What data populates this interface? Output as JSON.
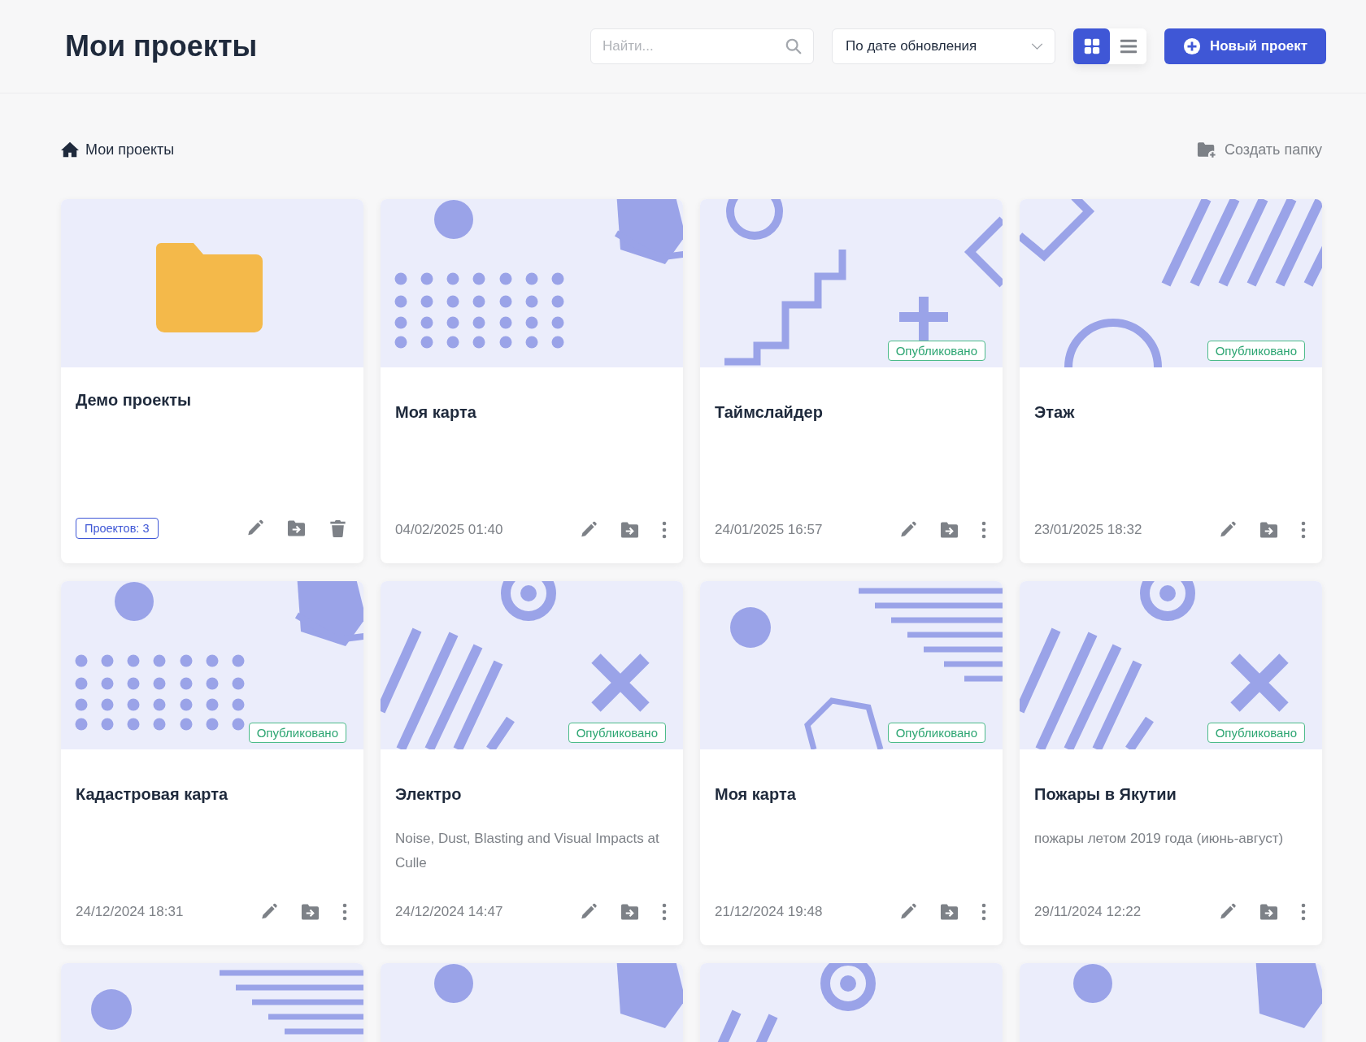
{
  "header": {
    "title": "Мои проекты",
    "search": {
      "placeholder": "Найти..."
    },
    "sort": {
      "value": "По дате обновления"
    },
    "view_modes": [
      {
        "kind": "grid",
        "selected": true
      },
      {
        "kind": "list",
        "selected": false
      }
    ],
    "new_button": "Новый проект"
  },
  "breadcrumb": {
    "label": "Мои проекты"
  },
  "create_folder": "Создать папку",
  "cards": [
    {
      "kind": "folder",
      "thumbnail": {
        "kind": "folder"
      },
      "published": false,
      "title": "Демо проекты",
      "count": "Проектов: 3"
    },
    {
      "kind": "project",
      "thumbnail": {
        "kind": "dots"
      },
      "published": false,
      "title": "Моя карта",
      "date": "04/02/2025 01:40"
    },
    {
      "kind": "project",
      "thumbnail": {
        "kind": "steps"
      },
      "published": true,
      "badge": "Опубликовано",
      "title": "Таймслайдер",
      "date": "24/01/2025 16:57"
    },
    {
      "kind": "project",
      "thumbnail": {
        "kind": "stripes"
      },
      "published": true,
      "badge": "Опубликовано",
      "title": "Этаж",
      "date": "23/01/2025 18:32"
    },
    {
      "kind": "project",
      "thumbnail": {
        "kind": "dots"
      },
      "published": true,
      "badge": "Опубликовано",
      "title": "Кадастровая карта",
      "date": "24/12/2024 18:31"
    },
    {
      "kind": "project",
      "thumbnail": {
        "kind": "cross"
      },
      "published": true,
      "badge": "Опубликовано",
      "title": "Электро",
      "description": "Noise, Dust, Blasting and Visual Impacts at Culle",
      "date": "24/12/2024 14:47"
    },
    {
      "kind": "project",
      "thumbnail": {
        "kind": "lines"
      },
      "published": true,
      "badge": "Опубликовано",
      "title": "Моя карта",
      "date": "21/12/2024 19:48"
    },
    {
      "kind": "project",
      "thumbnail": {
        "kind": "cross"
      },
      "published": true,
      "badge": "Опубликовано",
      "title": "Пожары в Якутии",
      "description": "пожары летом 2019 года (июнь-август)",
      "date": "29/11/2024 12:22"
    }
  ],
  "partial_cards": [
    {
      "thumbnail": {
        "kind": "lines"
      }
    },
    {
      "thumbnail": {
        "kind": "dots"
      }
    },
    {
      "thumbnail": {
        "kind": "cross"
      }
    },
    {
      "thumbnail": {
        "kind": "dots"
      }
    }
  ]
}
